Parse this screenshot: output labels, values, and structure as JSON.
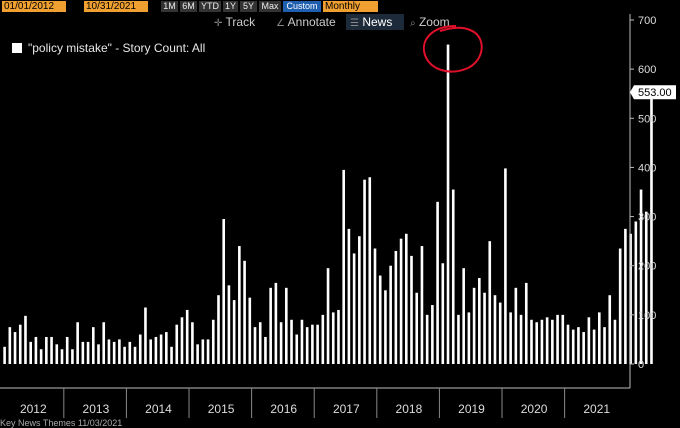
{
  "toolbar": {
    "start_date": "01/01/2012",
    "end_date": "10/31/2021",
    "ranges": [
      "1M",
      "6M",
      "YTD",
      "1Y",
      "5Y",
      "Max",
      "Custom"
    ],
    "active_range": "Custom",
    "frequency": "Monthly"
  },
  "menu": {
    "track": "Track",
    "annotate": "Annotate",
    "news": "News",
    "zoom": "Zoom"
  },
  "legend": {
    "label": "\"policy mistake\" - Story Count: All"
  },
  "last_value": "553.00",
  "footer": "Key News Themes   11/03/2021",
  "colors": {
    "background": "#000000",
    "bar": "#ffffff",
    "highlight": "#e0102a",
    "accent": "#f0a030"
  },
  "chart_data": {
    "type": "bar",
    "title": "",
    "xlabel": "",
    "ylabel": "",
    "ylim": [
      0,
      700
    ],
    "yticks": [
      0,
      100,
      200,
      300,
      400,
      500,
      600,
      700
    ],
    "year_labels": [
      "2012",
      "2013",
      "2014",
      "2015",
      "2016",
      "2017",
      "2018",
      "2019",
      "2020",
      "2021"
    ],
    "start": "2012-01",
    "series": [
      {
        "name": "\"policy mistake\" - Story Count: All",
        "values": [
          35,
          75,
          65,
          80,
          98,
          45,
          55,
          30,
          55,
          55,
          40,
          30,
          55,
          30,
          85,
          45,
          45,
          75,
          40,
          85,
          50,
          45,
          50,
          35,
          45,
          35,
          60,
          115,
          50,
          55,
          60,
          65,
          35,
          80,
          95,
          110,
          85,
          40,
          50,
          50,
          90,
          140,
          295,
          160,
          130,
          240,
          210,
          135,
          75,
          85,
          55,
          155,
          165,
          85,
          155,
          90,
          60,
          90,
          75,
          80,
          80,
          100,
          195,
          105,
          110,
          395,
          275,
          225,
          260,
          375,
          380,
          235,
          180,
          150,
          200,
          230,
          255,
          265,
          220,
          145,
          240,
          100,
          120,
          330,
          205,
          650,
          355,
          100,
          195,
          105,
          155,
          175,
          145,
          250,
          140,
          125,
          398,
          105,
          155,
          100,
          165,
          90,
          85,
          90,
          95,
          90,
          100,
          100,
          80,
          70,
          75,
          65,
          95,
          70,
          105,
          75,
          140,
          90,
          235,
          275,
          265,
          290,
          355,
          310,
          553
        ]
      }
    ]
  }
}
